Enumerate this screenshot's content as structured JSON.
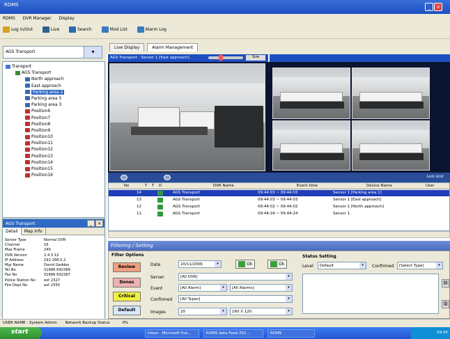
{
  "app": {
    "title": "RDMS"
  },
  "menu": [
    "RDMS",
    "DVR Manager",
    "Display"
  ],
  "toolbar": [
    {
      "label": "Log in/Out",
      "color": "#d8a020"
    },
    {
      "label": "Live",
      "color": "#306090"
    },
    {
      "label": "Search",
      "color": "#2a6ab0"
    },
    {
      "label": "Mod List",
      "color": "#3a7bc0"
    },
    {
      "label": "Alarm Log",
      "color": "#3a7bc0"
    }
  ],
  "sidebar": {
    "dropdown": "AGS Transport",
    "tree": [
      {
        "label": "Transport",
        "level": 0
      },
      {
        "label": "AGS Transport",
        "level": 1
      },
      {
        "label": "North approach",
        "level": 2
      },
      {
        "label": "East approach",
        "level": 2
      },
      {
        "label": "Parking area 2",
        "level": 2,
        "selected": true
      },
      {
        "label": "Parking area 5",
        "level": 2
      },
      {
        "label": "Parking area 3",
        "level": 2
      },
      {
        "label": "Position6",
        "level": 2
      },
      {
        "label": "Position7",
        "level": 2
      },
      {
        "label": "Position8",
        "level": 2
      },
      {
        "label": "Position9",
        "level": 2
      },
      {
        "label": "Position10",
        "level": 2
      },
      {
        "label": "Position11",
        "level": 2
      },
      {
        "label": "Position12",
        "level": 2
      },
      {
        "label": "Position13",
        "level": 2
      },
      {
        "label": "Position14",
        "level": 2
      },
      {
        "label": "Position15",
        "level": 2
      },
      {
        "label": "Position16",
        "level": 2
      }
    ],
    "props_title": "AGS Transport",
    "props_tabs": [
      "Detail",
      "Map Info"
    ],
    "props": [
      {
        "k": "Server Type",
        "v": "Normal DVR"
      },
      {
        "k": "Channel",
        "v": "16"
      },
      {
        "k": "Max Frame",
        "v": "240"
      },
      {
        "k": "DVR Version",
        "v": "2.4.3.12"
      },
      {
        "k": "IP Address",
        "v": "192.168.0.2"
      },
      {
        "k": "Mgr Name",
        "v": "David Geddes"
      },
      {
        "k": "Tel No",
        "v": "01686 692389"
      },
      {
        "k": "Fax No",
        "v": "01686 692387"
      },
      {
        "k": "Police Station No",
        "v": "ext 2327"
      },
      {
        "k": "Fire Dept No",
        "v": "ext 2350"
      }
    ]
  },
  "tabs": [
    "Live Display",
    "Alarm Management"
  ],
  "camera": {
    "title": "AGS Transport : Sensor 1 [East approach]",
    "size_label": "Size"
  },
  "grid": {
    "lock_label": "Lock Grid",
    "headers": [
      "No",
      "T",
      "T",
      "D",
      "DVR Name",
      "Event time",
      "Device Name",
      "User"
    ],
    "rows": [
      {
        "no": "14",
        "dvr": "AGS Transport",
        "time": "09:44:03 ~ 09:44:03",
        "device": "Sensor 1 [Parking area 1]",
        "selected": true
      },
      {
        "no": "13",
        "dvr": "AGS Transport",
        "time": "09:44:03 ~ 09:44:03",
        "device": "Sensor 1 [East approach]"
      },
      {
        "no": "12",
        "dvr": "AGS Transport",
        "time": "09:44:02 ~ 09:44:02",
        "device": "Sensor 1 [North approach]"
      },
      {
        "no": "11",
        "dvr": "AGS Transport",
        "time": "09:44:24 ~ 09:44:24",
        "device": "Sensor 1"
      }
    ]
  },
  "filter": {
    "title": "Filtering / Setting",
    "options_label": "Filter Options",
    "buttons": [
      {
        "label": "Review",
        "color": "#f0a080"
      },
      {
        "label": "Dones",
        "color": "#f0b0b0"
      },
      {
        "label": "Critical",
        "color": "#f0f040"
      },
      {
        "label": "Default",
        "color": "#d8e8ff"
      }
    ],
    "fields": [
      {
        "label": "Date",
        "value": "20/11/2006"
      },
      {
        "label": "Server",
        "value": "[All DVR]"
      },
      {
        "label": "Event",
        "value": "[All Alarm]"
      },
      {
        "label": "Confirmed",
        "value": "[All Types]"
      },
      {
        "label": "Images",
        "value": "20"
      }
    ],
    "event_extra": "[All Alarms]",
    "images_size": "160 X 120",
    "btn_ok": "Ok",
    "btn_ok2": "Ok",
    "status_setting": "Status Setting",
    "level_label": "Level",
    "level_value": "Default",
    "confirmed_label": "Confirmed",
    "confirmed_value": "[Select Type]"
  },
  "status": {
    "user": "USER NAME : System Admin",
    "network": "Network Backup Status",
    "percent": "0%"
  },
  "taskbar": {
    "start": "start",
    "tasks": [
      "Inbox - Microsoft Out...",
      "RDMS data Feed 201...",
      "RDMS"
    ],
    "clock": "09:45"
  }
}
